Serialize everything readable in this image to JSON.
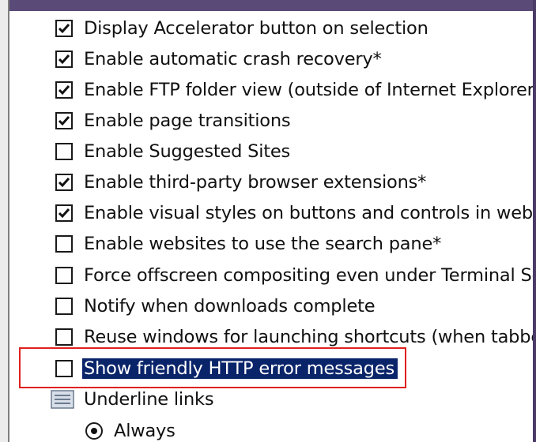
{
  "options": [
    {
      "label": "Display Accelerator button on selection",
      "checked": true
    },
    {
      "label": "Enable automatic crash recovery*",
      "checked": true
    },
    {
      "label": "Enable FTP folder view (outside of Internet Explorer)",
      "checked": true
    },
    {
      "label": "Enable page transitions",
      "checked": true
    },
    {
      "label": "Enable Suggested Sites",
      "checked": false
    },
    {
      "label": "Enable third-party browser extensions*",
      "checked": true
    },
    {
      "label": "Enable visual styles on buttons and controls in webpages",
      "checked": true
    },
    {
      "label": "Enable websites to use the search pane*",
      "checked": false
    },
    {
      "label": "Force offscreen compositing even under Terminal Server*",
      "checked": false
    },
    {
      "label": "Notify when downloads complete",
      "checked": false
    },
    {
      "label": "Reuse windows for launching shortcuts (when tabbed browsing is off)",
      "checked": false
    },
    {
      "label": "Show friendly HTTP error messages",
      "checked": false,
      "selected": true
    }
  ],
  "underline": {
    "label": "Underline links",
    "icon": "settings-group-icon",
    "radio_options": [
      {
        "label": "Always",
        "selected": true
      }
    ]
  },
  "colors": {
    "selection": "#0a246a",
    "highlight_box": "#e02020"
  }
}
